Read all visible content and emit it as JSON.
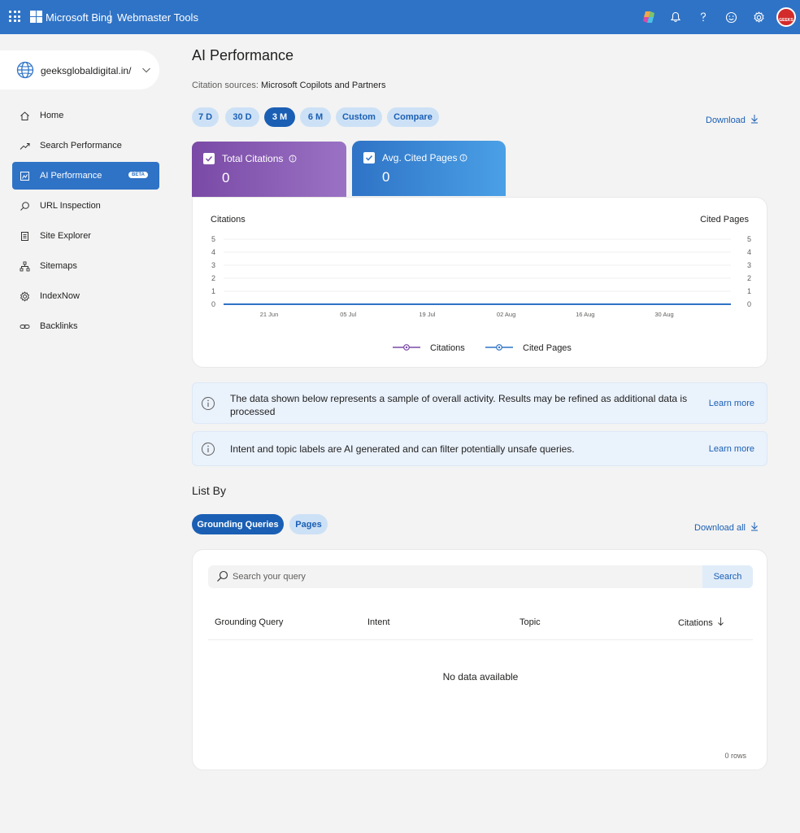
{
  "topbar": {
    "brand": "Microsoft Bing",
    "product": "Webmaster Tools",
    "avatar_text": "GEEKS"
  },
  "sidebar": {
    "site": "geeksglobaldigital.in/",
    "items": [
      {
        "label": "Home",
        "icon": "home-icon"
      },
      {
        "label": "Search Performance",
        "icon": "trend-icon"
      },
      {
        "label": "AI Performance",
        "icon": "ai-performance-icon",
        "badge": "BETA",
        "active": true
      },
      {
        "label": "URL Inspection",
        "icon": "search-icon"
      },
      {
        "label": "Site Explorer",
        "icon": "document-icon"
      },
      {
        "label": "Sitemaps",
        "icon": "sitemap-icon"
      },
      {
        "label": "IndexNow",
        "icon": "gear-icon"
      },
      {
        "label": "Backlinks",
        "icon": "link-icon"
      }
    ]
  },
  "main": {
    "title": "AI Performance",
    "citation_sources_label": "Citation sources:",
    "citation_sources_value": "Microsoft Copilots and Partners",
    "ranges": [
      "7 D",
      "30 D",
      "3 M",
      "6 M",
      "Custom",
      "Compare"
    ],
    "active_range": "3 M",
    "download_label": "Download",
    "metrics": {
      "citations": {
        "label": "Total Citations",
        "value": "0",
        "checked": true
      },
      "cited_pages": {
        "label": "Avg. Cited Pages",
        "value": "0",
        "checked": true
      }
    },
    "info_boxes": [
      {
        "text": "The data shown below represents a sample of overall activity. Results may be refined as additional data is processed",
        "link": "Learn more"
      },
      {
        "text": "Intent and topic labels are AI generated and can filter potentially unsafe queries.",
        "link": "Learn more"
      }
    ],
    "list_by": {
      "title": "List By",
      "tabs": [
        "Grounding Queries",
        "Pages"
      ],
      "active_tab": "Grounding Queries",
      "download_all_label": "Download all"
    },
    "table": {
      "search_placeholder": "Search your query",
      "search_button": "Search",
      "columns": [
        "Grounding Query",
        "Intent",
        "Topic",
        "Citations"
      ],
      "empty_message": "No data available",
      "row_count": "0 rows"
    }
  },
  "colors": {
    "accent": "#2f73c6",
    "citations_series": "#7a4aa6",
    "cited_pages_series": "#2f73c6"
  },
  "chart_data": {
    "type": "line",
    "ylabel": "Citations",
    "ylabel_right": "Cited Pages",
    "ylim": [
      0,
      5
    ],
    "y_ticks": [
      "0",
      "1",
      "2",
      "3",
      "4",
      "5"
    ],
    "y2_ticks": [
      "0",
      "1",
      "2",
      "3",
      "4",
      "5"
    ],
    "x_tick_labels": [
      "21 Jun",
      "05 Jul",
      "19 Jul",
      "02 Aug",
      "16 Aug",
      "30 Aug"
    ],
    "series": [
      {
        "name": "Citations",
        "values": [
          0,
          0,
          0,
          0,
          0,
          0
        ],
        "color": "#7a4aa6"
      },
      {
        "name": "Cited Pages",
        "values": [
          0,
          0,
          0,
          0,
          0,
          0
        ],
        "color": "#2f73c6"
      }
    ],
    "grid": true,
    "legend": "bottom-center"
  }
}
